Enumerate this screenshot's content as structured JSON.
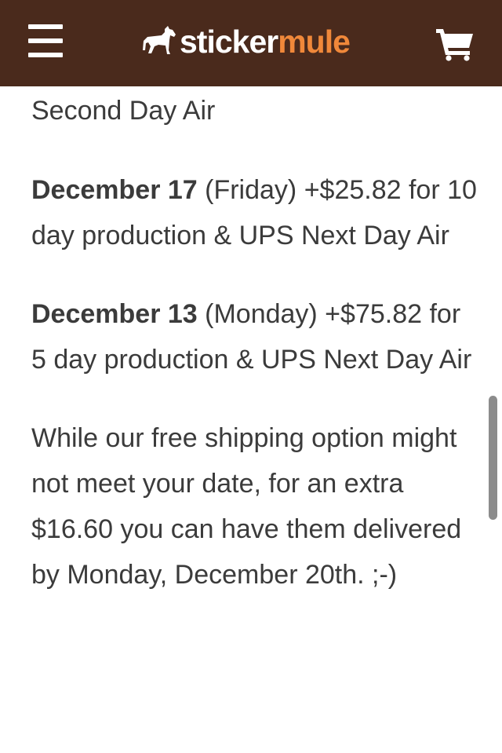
{
  "header": {
    "brand_word_1": "sticker",
    "brand_word_2": "mule",
    "menu_icon": "hamburger-menu-icon",
    "logo_icon": "mule-icon",
    "cart_icon": "shopping-cart-icon",
    "colors": {
      "background": "#4a2a1c",
      "brand_accent": "#f0883a",
      "text": "#ffffff"
    }
  },
  "content": {
    "line_1": "Second Day Air",
    "option_1": {
      "date": "December 17",
      "rest": " (Friday) +$25.82 for 10 day production & UPS Next Day Air"
    },
    "option_2": {
      "date": "December 13",
      "rest": " (Monday) +$75.82 for 5 day production & UPS Next Day Air"
    },
    "closing": "While our free shipping option might not meet your date, for an extra $16.60 you can have them delivered by Monday, December 20th. ;-)"
  }
}
